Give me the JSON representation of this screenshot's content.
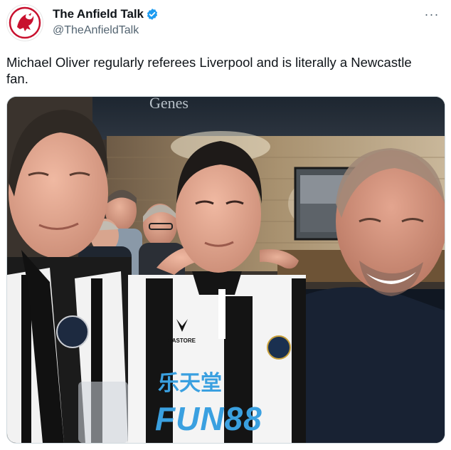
{
  "account": {
    "display_name": "The Anfield Talk",
    "handle": "@TheAnfieldTalk",
    "verified": true,
    "avatar_icon": "liverbird-crest-icon",
    "accent": "#c8102e"
  },
  "tweet": {
    "text": "Michael Oliver regularly referees Liverpool and is literally a Newcastle fan."
  },
  "menu": {
    "icon": "more-options-icon",
    "label": "···"
  },
  "media": {
    "description_icon": "photo-image",
    "sign_text": "Genes",
    "shirt_brand": "CASTORE",
    "shirt_sponsor_top": "乐天堂",
    "shirt_sponsor": "FUN88"
  },
  "colors": {
    "verified_blue": "#1d9bf0",
    "sponsor_blue": "#3aa0e0",
    "text_primary": "#0f1419",
    "text_secondary": "#536471"
  }
}
